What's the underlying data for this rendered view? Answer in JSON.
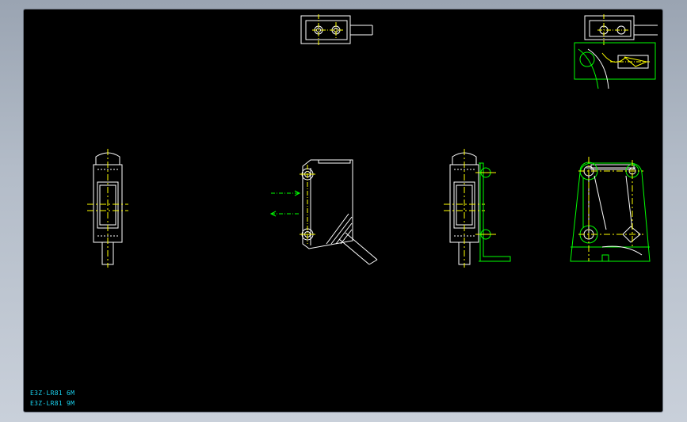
{
  "drawing": {
    "colors": {
      "line": "#ffffff",
      "center": "#ffff00",
      "bracket": "#00ff00",
      "dim": "#00ff00",
      "label": "#19d3f0",
      "background": "#000000"
    },
    "labels": [
      "E3Z-LR81 6M",
      "E3Z-LR81 9M"
    ]
  }
}
